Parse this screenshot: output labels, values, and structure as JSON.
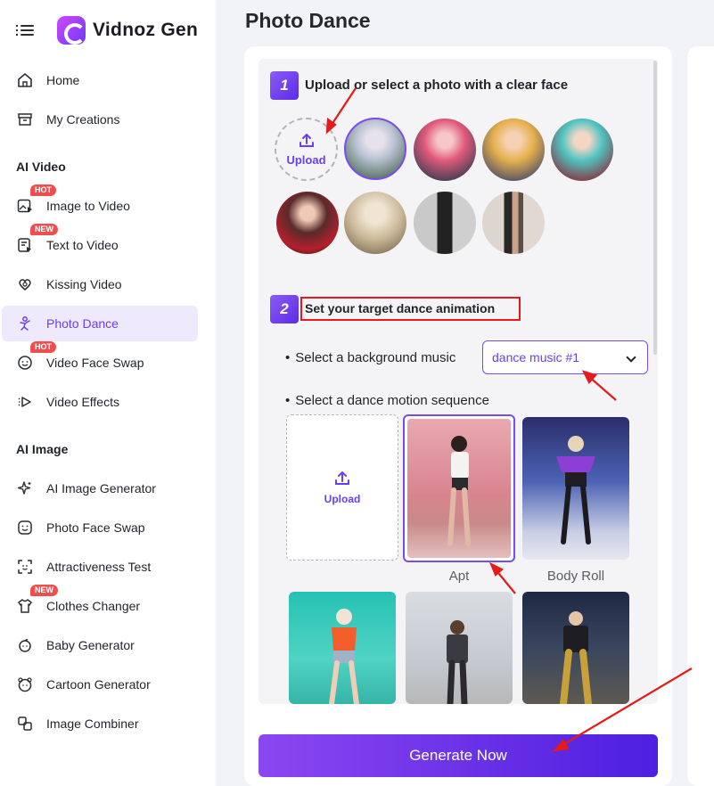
{
  "brand": {
    "name": "Vidnoz Gen"
  },
  "sidebar": {
    "items": [
      {
        "label": "Home",
        "icon": "home-icon"
      },
      {
        "label": "My Creations",
        "icon": "archive-icon"
      }
    ],
    "sections": [
      {
        "title": "AI Video",
        "items": [
          {
            "label": "Image to Video",
            "icon": "image-video-icon",
            "badge": "HOT"
          },
          {
            "label": "Text to Video",
            "icon": "text-doc-icon",
            "badge": "NEW"
          },
          {
            "label": "Kissing Video",
            "icon": "kiss-icon"
          },
          {
            "label": "Photo Dance",
            "icon": "dance-icon",
            "active": true
          },
          {
            "label": "Video Face Swap",
            "icon": "face-swap-icon",
            "badge": "HOT"
          },
          {
            "label": "Video Effects",
            "icon": "effects-icon"
          }
        ]
      },
      {
        "title": "AI Image",
        "items": [
          {
            "label": "AI Image Generator",
            "icon": "sparkle-icon"
          },
          {
            "label": "Photo Face Swap",
            "icon": "smile-icon"
          },
          {
            "label": "Attractiveness Test",
            "icon": "face-scan-icon"
          },
          {
            "label": "Clothes Changer",
            "icon": "shirt-icon",
            "badge": "NEW"
          },
          {
            "label": "Baby Generator",
            "icon": "baby-icon"
          },
          {
            "label": "Cartoon Generator",
            "icon": "cartoon-icon"
          },
          {
            "label": "Image Combiner",
            "icon": "combine-icon"
          }
        ]
      }
    ]
  },
  "main": {
    "title": "Photo Dance",
    "step1": {
      "number": "1",
      "text": "Upload or select a photo with a clear face",
      "upload_label": "Upload"
    },
    "step2": {
      "number": "2",
      "text": "Set your target dance animation",
      "music_label": "Select a background music",
      "music_value": "dance music #1",
      "motion_label": "Select a dance motion sequence",
      "upload_label": "Upload",
      "motions": [
        {
          "label": "Apt",
          "selected": true
        },
        {
          "label": "Body Roll",
          "selected": false
        }
      ]
    },
    "generate_label": "Generate Now"
  },
  "colors": {
    "accent": "#6a3ff2",
    "active_bg": "#efe9fd",
    "badge": "#f04e4e",
    "highlight": "#e8191c"
  }
}
